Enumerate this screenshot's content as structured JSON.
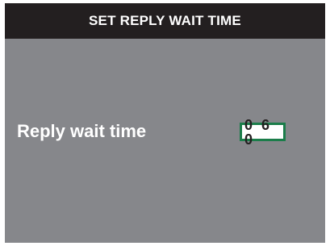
{
  "header": {
    "title": "SET REPLY WAIT TIME"
  },
  "setting": {
    "label": "Reply wait time",
    "value": "0 6 0"
  },
  "colors": {
    "screen_background": "#86878b",
    "title_bar": "#231f20",
    "title_text": "#ffffff",
    "value_border": "#1b7d4a",
    "value_background": "#ffffff"
  }
}
